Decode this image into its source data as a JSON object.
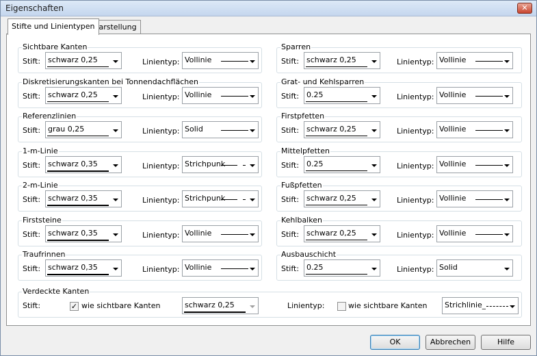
{
  "window": {
    "title": "Eigenschaften",
    "close_glyph": "✕"
  },
  "tabs": [
    {
      "label": "Stifte und Linientypen",
      "active": true
    },
    {
      "label": "Darstellung",
      "active": false
    }
  ],
  "labels": {
    "pen": "Stift:",
    "linetype": "Linientyp:"
  },
  "left_groups": [
    {
      "title": "Sichtbare Kanten",
      "pen": "schwarz 0,25",
      "pen_weight": "thin",
      "linetype": "Vollinie",
      "linestyle": "solid"
    },
    {
      "title": "Diskretisierungskanten bei Tonnendachflächen",
      "pen": "schwarz 0,25",
      "pen_weight": "thin",
      "linetype": "Vollinie",
      "linestyle": "solid"
    },
    {
      "title": "Referenzlinien",
      "pen": "grau 0,25",
      "pen_weight": "thin",
      "linetype": "Solid",
      "linestyle": "solid"
    },
    {
      "title": "1-m-Linie",
      "pen": "schwarz 0,35",
      "pen_weight": "thick",
      "linetype": "Strichpunk",
      "linestyle": "dashdot"
    },
    {
      "title": "2-m-Linie",
      "pen": "schwarz 0,35",
      "pen_weight": "thick",
      "linetype": "Strichpunk",
      "linestyle": "dashdot"
    },
    {
      "title": "Firststeine",
      "pen": "schwarz 0,35",
      "pen_weight": "thick",
      "linetype": "Vollinie",
      "linestyle": "solid"
    },
    {
      "title": "Traufrinnen",
      "pen": "schwarz 0,35",
      "pen_weight": "thick",
      "linetype": "Vollinie",
      "linestyle": "solid"
    }
  ],
  "right_groups": [
    {
      "title": "Sparren",
      "pen": "schwarz 0,25",
      "pen_weight": "thin",
      "linetype": "Vollinie",
      "linestyle": "solid"
    },
    {
      "title": "Grat- und Kehlsparren",
      "pen": "0.25",
      "pen_weight": "thin",
      "linetype": "Vollinie",
      "linestyle": "solid"
    },
    {
      "title": "Firstpfetten",
      "pen": "schwarz 0,25",
      "pen_weight": "thin",
      "linetype": "Vollinie",
      "linestyle": "solid"
    },
    {
      "title": "Mittelpfetten",
      "pen": "0.25",
      "pen_weight": "thin",
      "linetype": "Vollinie",
      "linestyle": "solid"
    },
    {
      "title": "Fußpfetten",
      "pen": "schwarz 0,25",
      "pen_weight": "thin",
      "linetype": "Vollinie",
      "linestyle": "solid"
    },
    {
      "title": "Kehlbalken",
      "pen": "schwarz 0,25",
      "pen_weight": "thin",
      "linetype": "Vollinie",
      "linestyle": "solid"
    },
    {
      "title": "Ausbauschicht",
      "pen": "0.25",
      "pen_weight": "thin",
      "linetype": "Solid",
      "linestyle": "none"
    }
  ],
  "hidden_edges": {
    "title": "Verdeckte Kanten",
    "pen_label": "Stift:",
    "pen_same_checkbox": "wie sichtbare Kanten",
    "pen_same_checked": true,
    "pen_value": "schwarz 0,25",
    "linetype_label": "Linientyp:",
    "linetype_same_checkbox": "wie sichtbare Kanten",
    "linetype_same_checked": false,
    "linetype_value": "Strichlinie_",
    "check_glyph": "✓"
  },
  "buttons": {
    "ok": "OK",
    "cancel": "Abbrechen",
    "help": "Hilfe"
  }
}
